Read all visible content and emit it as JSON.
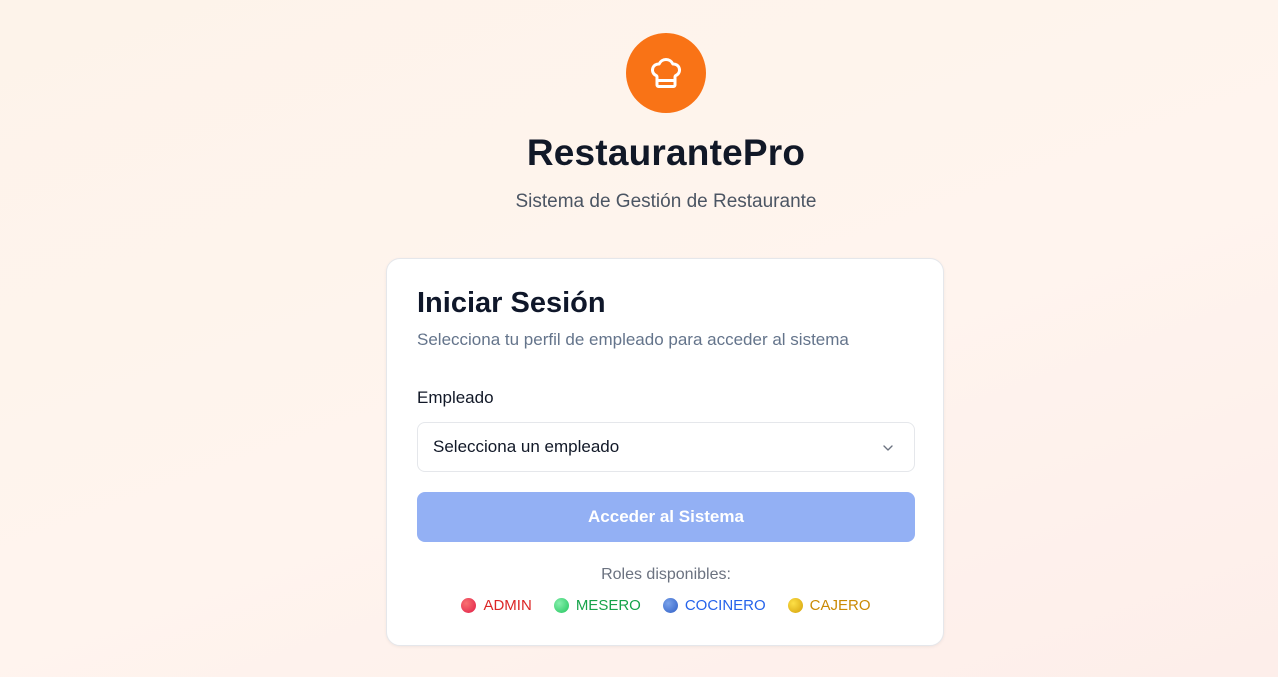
{
  "brand": {
    "icon": "chef-hat-icon",
    "title": "RestaurantePro",
    "subtitle": "Sistema de Gestión de Restaurante",
    "accent_color": "#f97316"
  },
  "login": {
    "title": "Iniciar Sesión",
    "description": "Selecciona tu perfil de empleado para acceder al sistema",
    "employee_label": "Empleado",
    "employee_select": {
      "placeholder": "Selecciona un empleado",
      "icon": "chevron-down-icon"
    },
    "submit_label": "Acceder al Sistema",
    "submit_color": "#93b0f4"
  },
  "roles": {
    "label": "Roles disponibles:",
    "items": [
      {
        "label": "ADMIN",
        "color": "#dc2626",
        "dot_color": "#e11d48"
      },
      {
        "label": "MESERO",
        "color": "#16a34a",
        "dot_color": "#34d399"
      },
      {
        "label": "COCINERO",
        "color": "#2563eb",
        "dot_color": "#3b73d6"
      },
      {
        "label": "CAJERO",
        "color": "#ca8a04",
        "dot_color": "#eab308"
      }
    ]
  }
}
